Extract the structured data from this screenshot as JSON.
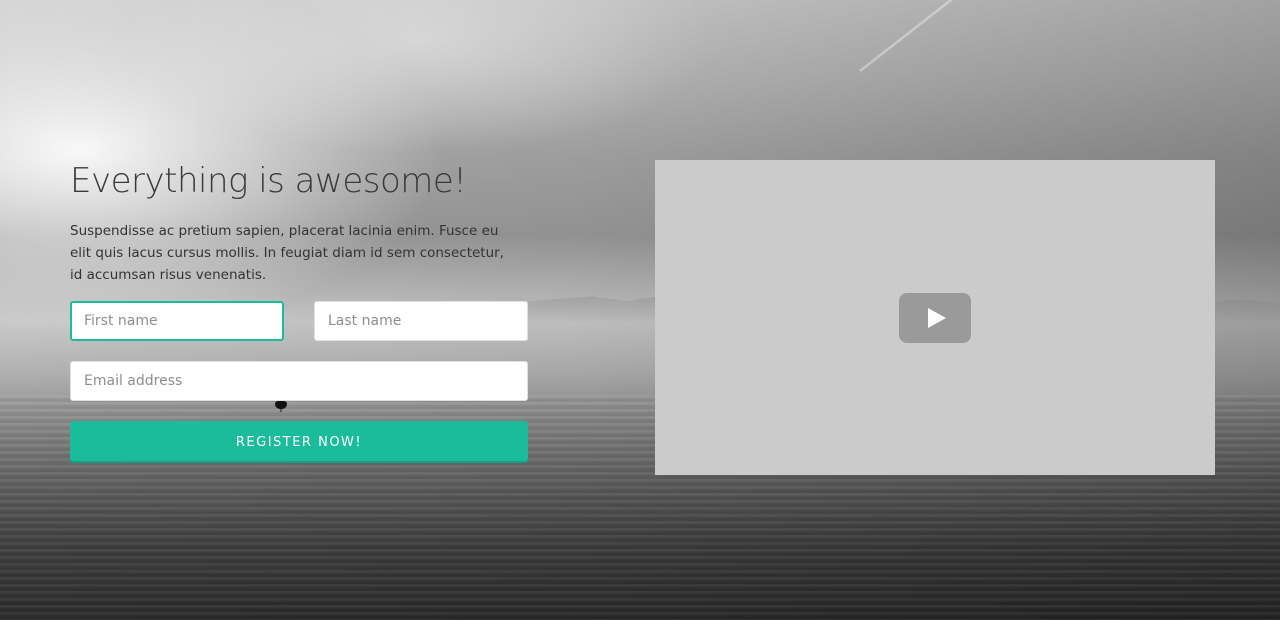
{
  "hero": {
    "headline": "Everything is awesome!",
    "description": "Suspendisse ac pretium sapien, placerat lacinia enim. Fusce eu elit quis lacus cursus mollis. In feugiat diam id sem consectetur, id accumsan risus venenatis."
  },
  "form": {
    "first_name": {
      "placeholder": "First name",
      "value": ""
    },
    "last_name": {
      "placeholder": "Last name",
      "value": ""
    },
    "email": {
      "placeholder": "Email address",
      "value": ""
    },
    "submit_label": "REGISTER NOW!"
  },
  "video": {
    "play_icon": "play-icon"
  },
  "colors": {
    "accent": "#1abc9c",
    "video_background": "#cbcbcb",
    "play_button": "#9a9a9a",
    "headline_text": "#3a3a3a"
  }
}
